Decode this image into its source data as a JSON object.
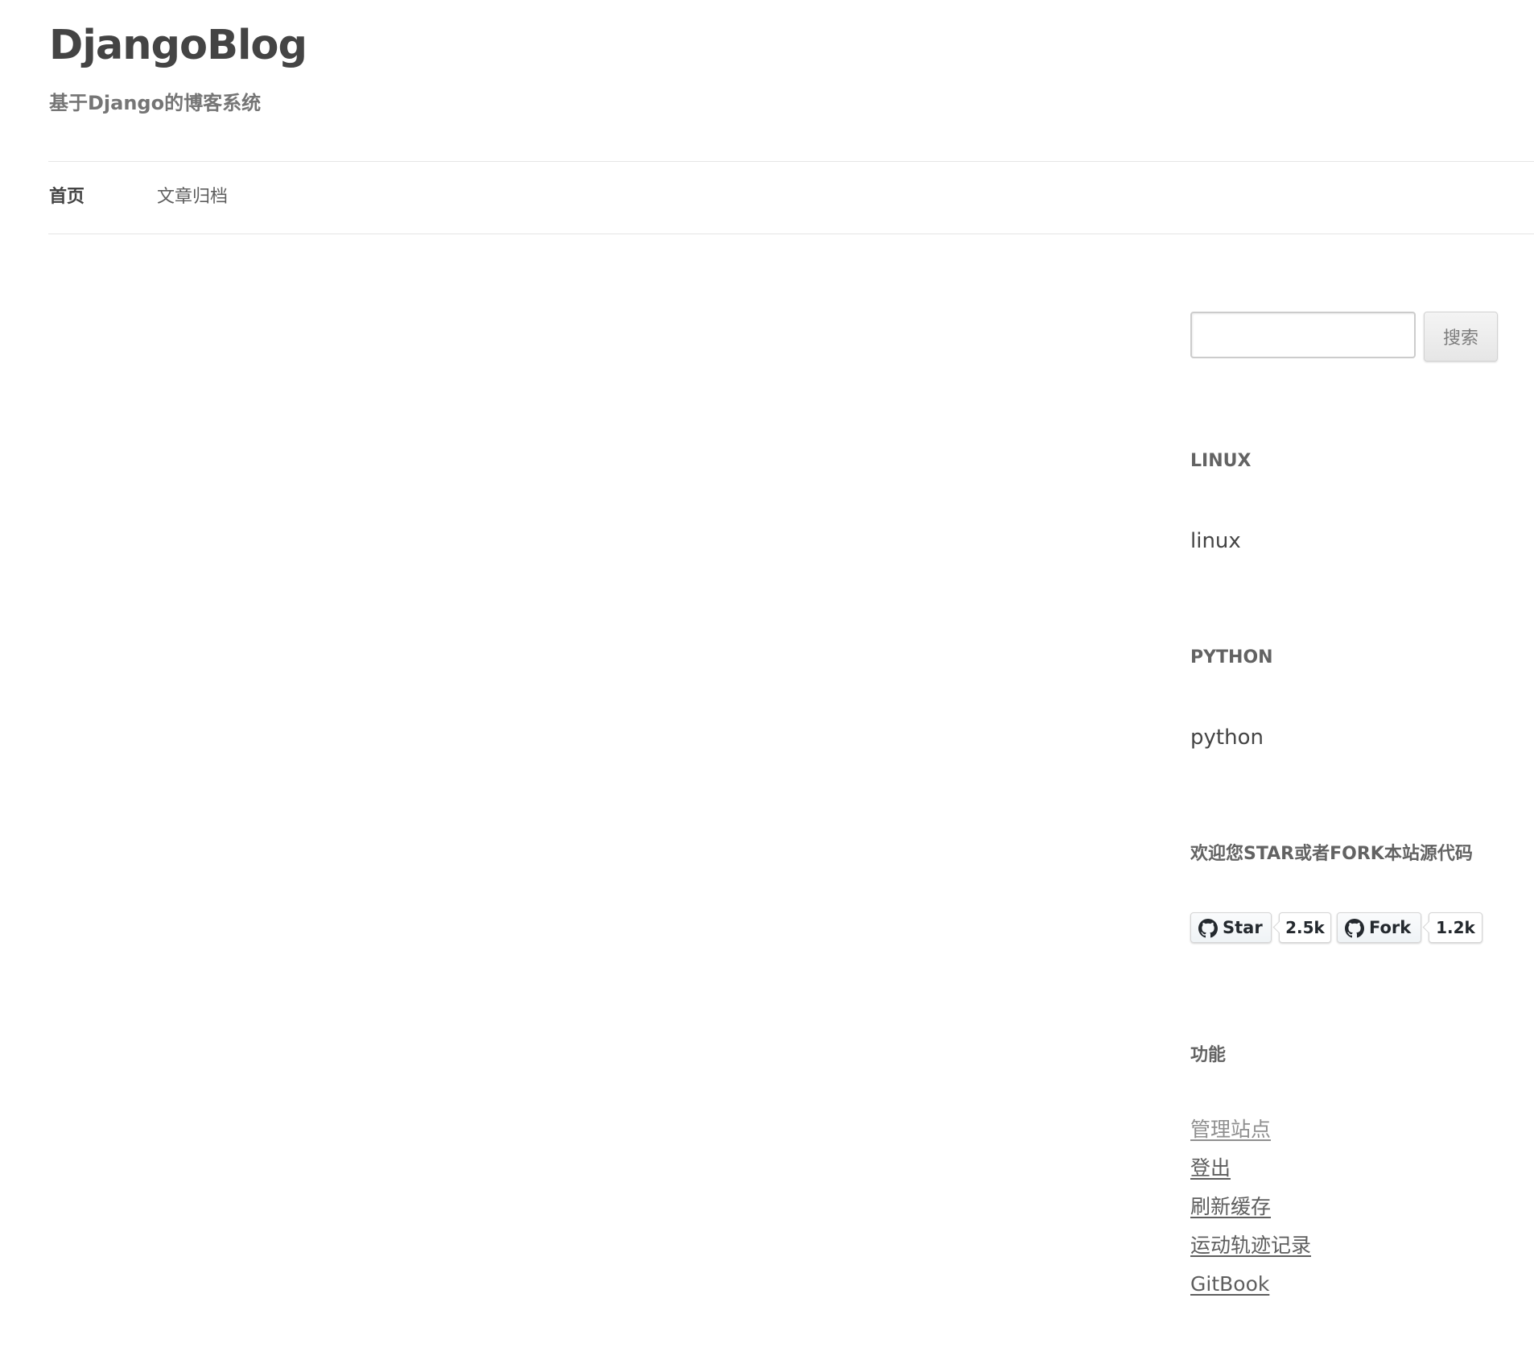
{
  "header": {
    "site_title": "DjangoBlog",
    "site_subtitle": "基于Django的博客系统"
  },
  "nav": {
    "items": [
      {
        "label": "首页",
        "active": true
      },
      {
        "label": "文章归档",
        "active": false
      }
    ]
  },
  "sidebar": {
    "search": {
      "value": "",
      "placeholder": "",
      "button_label": "搜索"
    },
    "widgets": [
      {
        "title": "LINUX",
        "text": "linux"
      },
      {
        "title": "PYTHON",
        "text": "python"
      }
    ],
    "github": {
      "title": "欢迎您STAR或者FORK本站源代码",
      "star_label": "Star",
      "star_count": "2.5k",
      "fork_label": "Fork",
      "fork_count": "1.2k",
      "icon": "github-icon"
    },
    "functions": {
      "title": "功能",
      "links": [
        "管理站点",
        "登出",
        "刷新缓存",
        "运动轨迹记录",
        "GitBook"
      ]
    }
  },
  "colors": {
    "text": "#444444",
    "muted": "#757575",
    "border": "#e5e5e5"
  }
}
